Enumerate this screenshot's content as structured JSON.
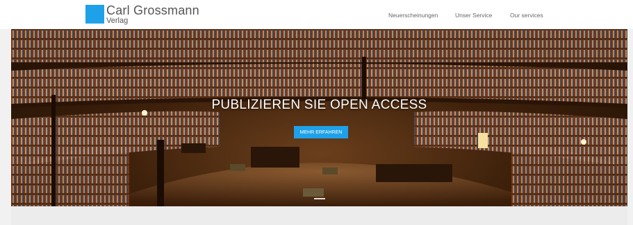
{
  "header": {
    "logo": {
      "name": "Carl Grossmann",
      "sub": "Verlag",
      "color": "#1ea1e8"
    },
    "nav": [
      {
        "label": "Neuerscheinungen"
      },
      {
        "label": "Unser Service"
      },
      {
        "label": "Our services"
      }
    ]
  },
  "hero": {
    "title": "PUBLIZIEREN SIE OPEN ACCESS",
    "button_label": "MEHR ERFAHREN",
    "button_color": "#1ea1e8",
    "image": "library-interior"
  }
}
